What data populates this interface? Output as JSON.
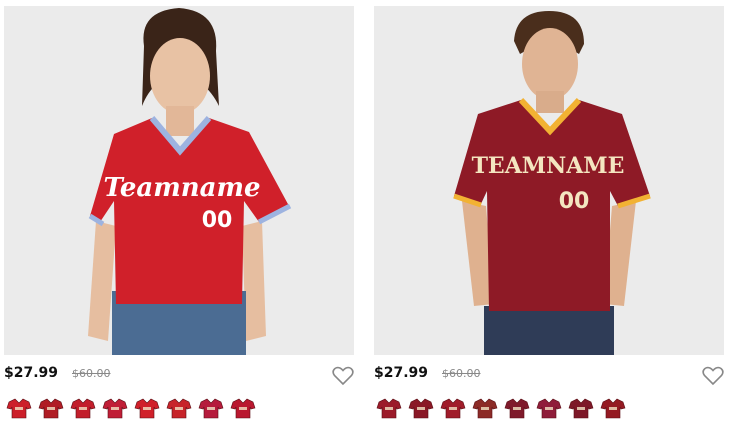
{
  "products": [
    {
      "jersey_color": "#d0202a",
      "trim_color": "#9db3e0",
      "team_text": "Teamname",
      "number_text": "00",
      "text_color": "#ffffff",
      "price": "$27.99",
      "old_price": "$60.00",
      "swatch_colors": [
        "#cc1f2a",
        "#b01d25",
        "#c21e2b",
        "#c01e36",
        "#d0202a",
        "#c7242a",
        "#b51b3c",
        "#b9172f"
      ]
    },
    {
      "jersey_color": "#8e1a26",
      "trim_color": "#f2b233",
      "team_text": "TEAMNAME",
      "number_text": "00",
      "text_color": "#f4e6c0",
      "price": "$27.99",
      "old_price": "$60.00",
      "swatch_colors": [
        "#9b1b2a",
        "#8a1826",
        "#a01c2a",
        "#8c2b27",
        "#7f1a2b",
        "#8f1d3a",
        "#7d1828",
        "#941a22"
      ]
    }
  ],
  "icons": {
    "wishlist": "heart-icon",
    "swatch": "jersey-icon"
  }
}
